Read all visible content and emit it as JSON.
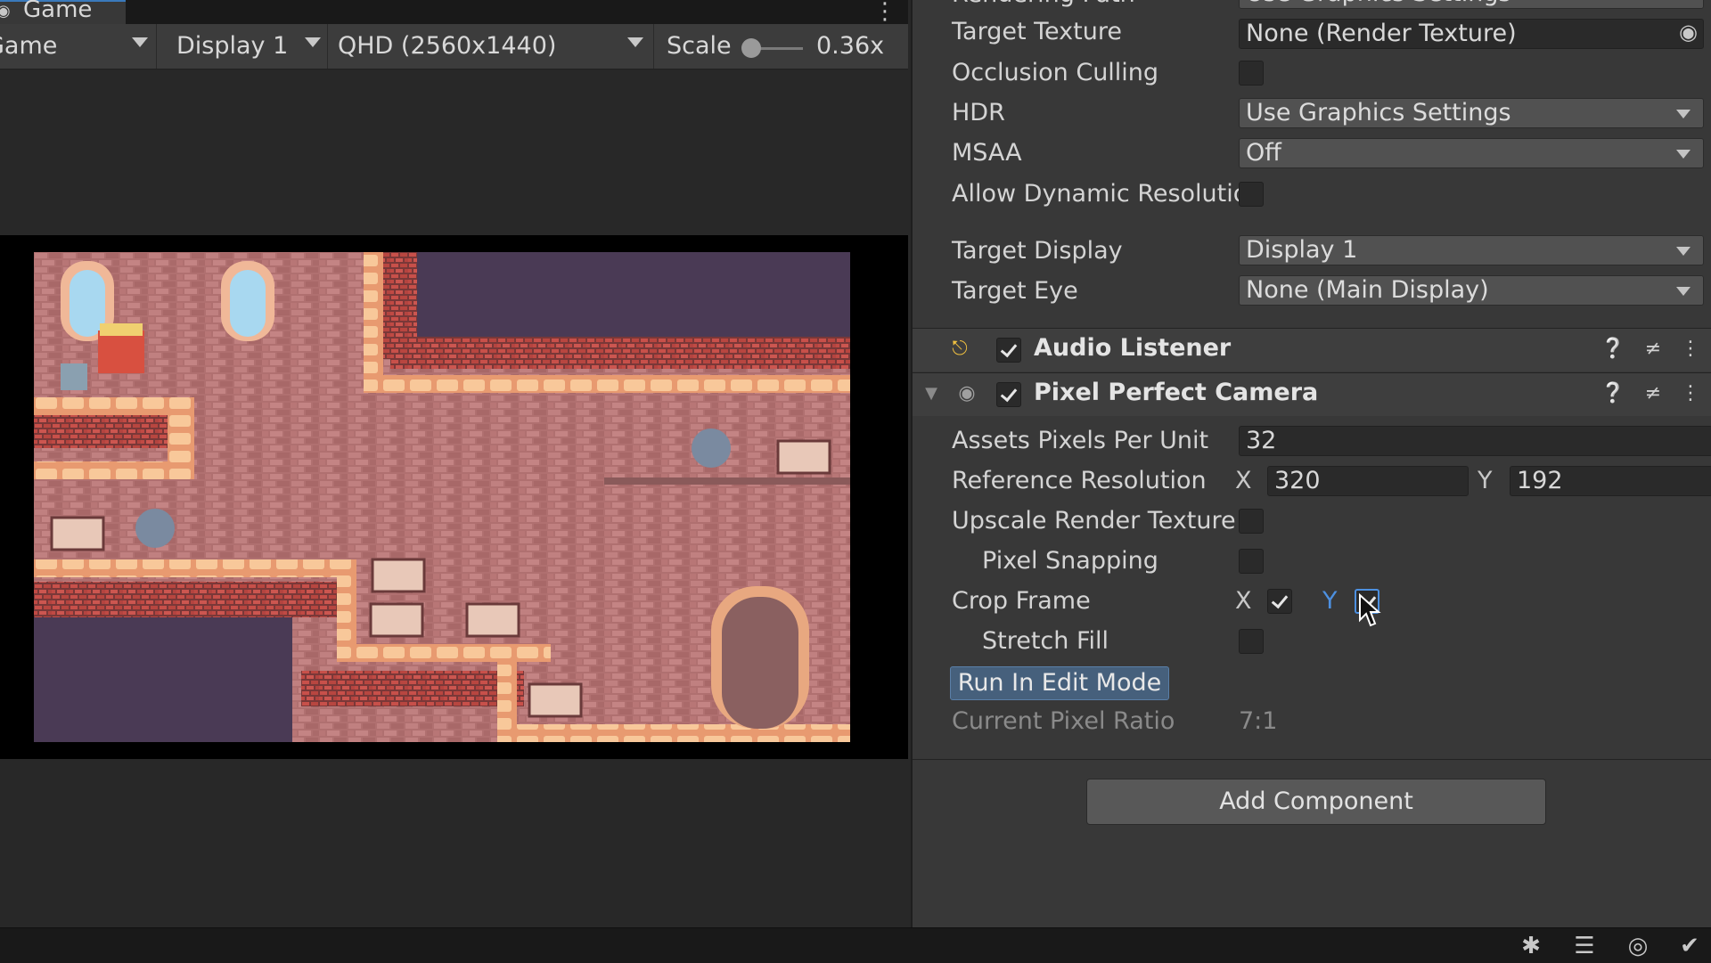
{
  "game_view": {
    "tab_label": "Game",
    "mode_dropdown": "Game",
    "display_dropdown": "Display 1",
    "resolution_dropdown": "QHD (2560x1440)",
    "scale_label": "Scale",
    "scale_value": "0.36x"
  },
  "camera": {
    "rendering_path_label": "Rendering Path",
    "rendering_path_value": "Use Graphics Settings",
    "target_texture_label": "Target Texture",
    "target_texture_value": "None (Render Texture)",
    "occlusion_label": "Occlusion Culling",
    "hdr_label": "HDR",
    "hdr_value": "Use Graphics Settings",
    "msaa_label": "MSAA",
    "msaa_value": "Off",
    "dynamic_res_label": "Allow Dynamic Resolutio",
    "target_display_label": "Target Display",
    "target_display_value": "Display 1",
    "target_eye_label": "Target Eye",
    "target_eye_value": "None (Main Display)"
  },
  "audio_listener": {
    "title": "Audio Listener",
    "enabled": true
  },
  "pixel_perfect": {
    "title": "Pixel Perfect Camera",
    "enabled": true,
    "assets_ppu_label": "Assets Pixels Per Unit",
    "assets_ppu_value": "32",
    "ref_res_label": "Reference Resolution",
    "ref_x_label": "X",
    "ref_x_value": "320",
    "ref_y_label": "Y",
    "ref_y_value": "192",
    "upscale_label": "Upscale Render Texture",
    "pixel_snapping_label": "Pixel Snapping",
    "crop_frame_label": "Crop Frame",
    "crop_x_label": "X",
    "crop_y_label": "Y",
    "stretch_fill_label": "Stretch Fill",
    "run_edit_label": "Run In Edit Mode",
    "pixel_ratio_label": "Current Pixel Ratio",
    "pixel_ratio_value": "7:1"
  },
  "add_component_label": "Add Component"
}
